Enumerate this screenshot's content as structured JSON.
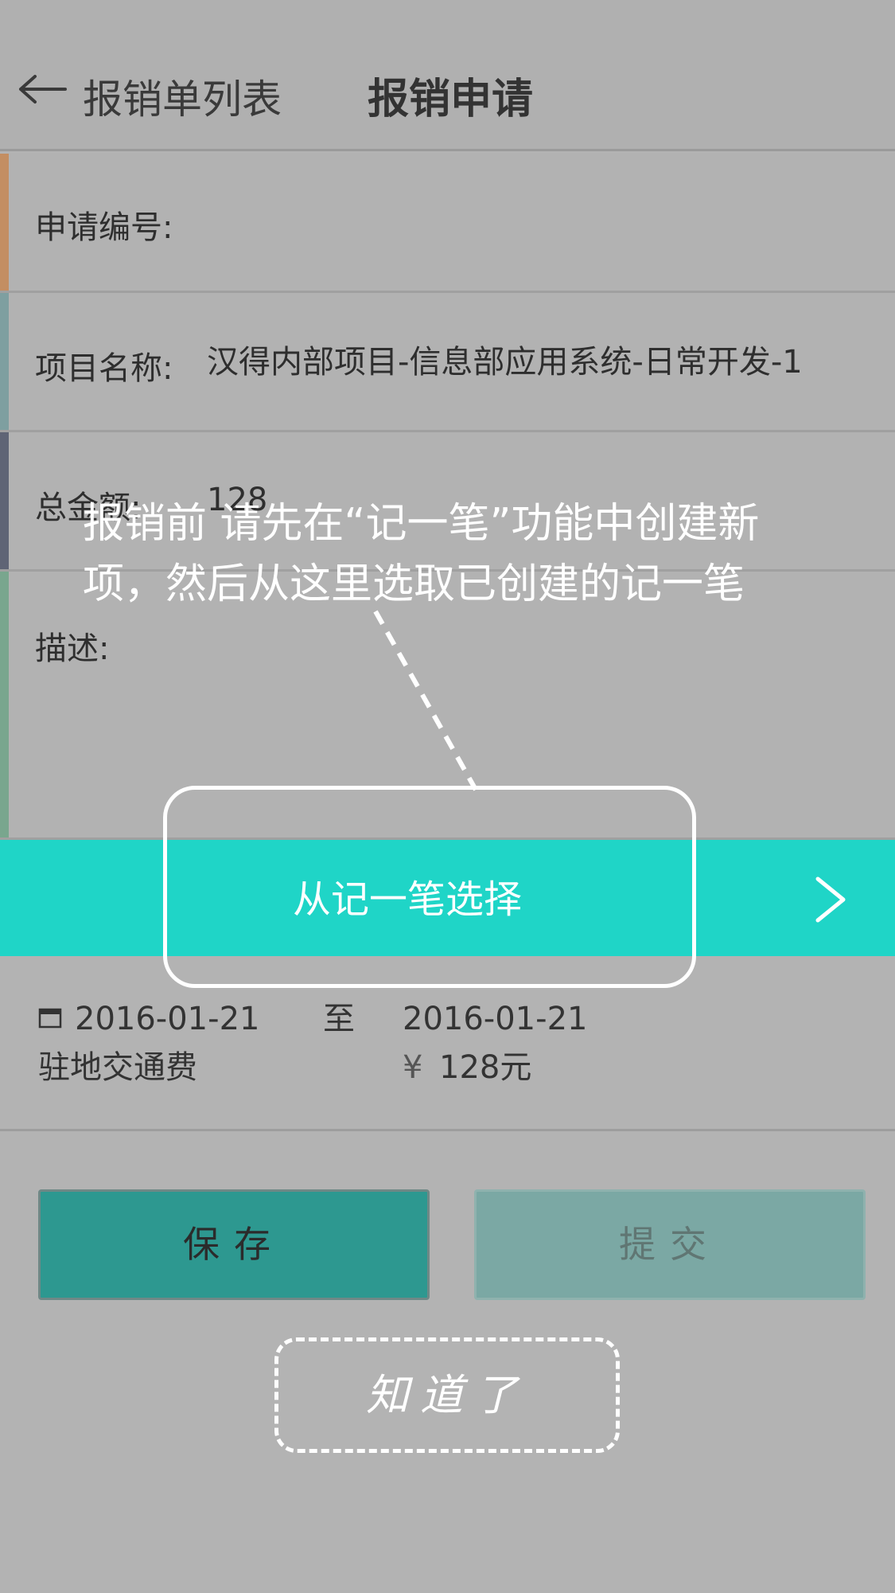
{
  "header": {
    "back_label": "报销单列表",
    "title": "报销申请"
  },
  "form": {
    "apply_no_label": "申请编号:",
    "apply_no_value": "",
    "project_label": "项目名称:",
    "project_value": "汉得内部项目-信息部应用系统-日常开发-1",
    "amount_label": "总金额:",
    "amount_value": "128",
    "desc_label": "描述:",
    "stripe_colors": [
      "#c38e62",
      "#7e9fa0",
      "#5f6475",
      "#79a68e"
    ]
  },
  "select_bar": {
    "label": "从记一笔选择"
  },
  "entry": {
    "date_from": "2016-01-21",
    "to_label": "至",
    "date_to": "2016-01-21",
    "category": "驻地交通费",
    "currency_symbol": "¥",
    "amount": "128元"
  },
  "actions": {
    "save_label": "保存",
    "submit_label": "提交"
  },
  "guide": {
    "line1": "报销前 请先在“记一笔”功能中创建新",
    "line2": "项，然后从这里选取已创建的记一笔",
    "got_it_label": "知道了"
  },
  "colors": {
    "accent_teal": "#1fd5c7",
    "save_button": "#2d9890",
    "submit_button_disabled": "#7ba8a4"
  }
}
